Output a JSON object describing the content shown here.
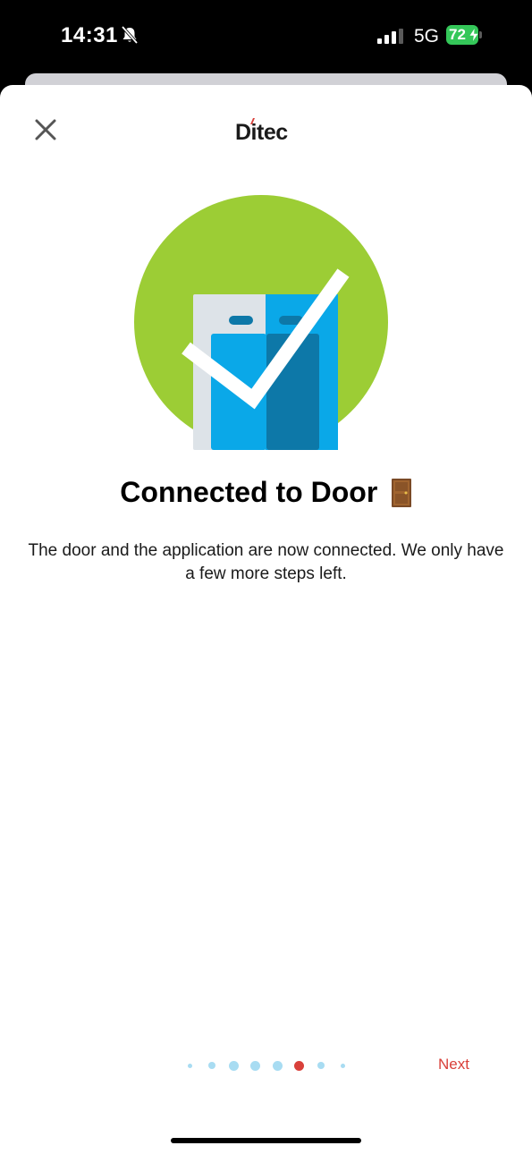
{
  "status_bar": {
    "time": "14:31",
    "network": "5G",
    "battery_level": "72",
    "bell_icon": "bell-slash-icon",
    "signal_icon": "cellular-signal-icon",
    "battery_color": "#34c759"
  },
  "header": {
    "close_icon": "close-icon",
    "logo_text": "Ditec"
  },
  "main": {
    "hero_icon": "door-connected-check-icon",
    "title": "Connected to Door",
    "title_emoji_icon": "door-icon",
    "description": "The door and the application are now connected. We only have a few more steps left."
  },
  "footer": {
    "pager_total": 8,
    "pager_active_index": 5,
    "next_label": "Next"
  },
  "colors": {
    "accent": "#d9403a",
    "hero_green": "#9ccd35",
    "door_blue": "#0aa8e8",
    "door_dark_blue": "#0d78a8",
    "dot_inactive": "#a8dcf2"
  }
}
